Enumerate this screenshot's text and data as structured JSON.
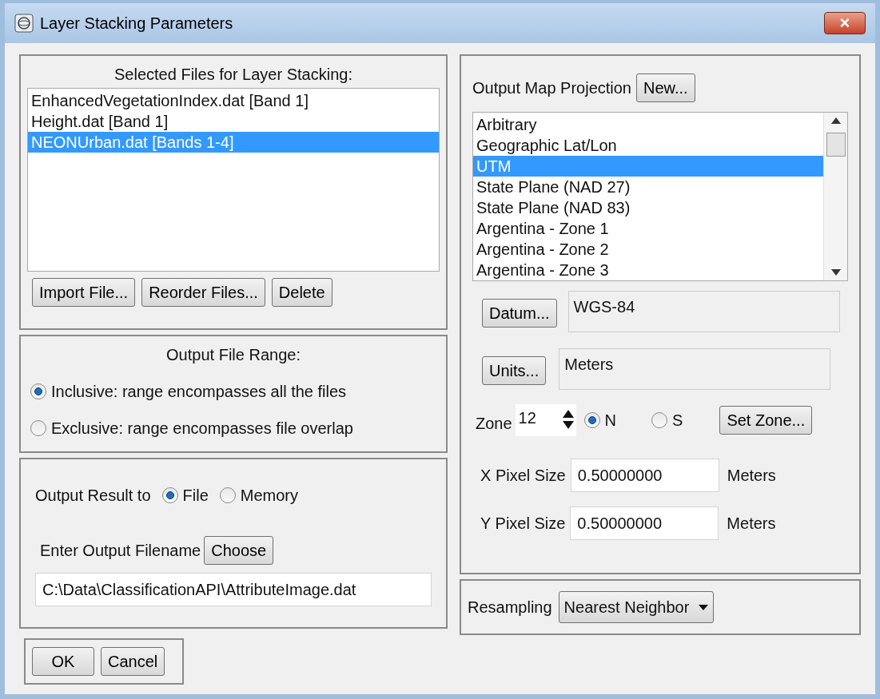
{
  "window": {
    "title": "Layer Stacking Parameters",
    "close": "×"
  },
  "files": {
    "title": "Selected Files for Layer Stacking:",
    "items": [
      {
        "label": "EnhancedVegetationIndex.dat [Band 1]",
        "selected": false
      },
      {
        "label": "Height.dat [Band 1]",
        "selected": false
      },
      {
        "label": "NEONUrban.dat [Bands 1-4]",
        "selected": true
      }
    ],
    "buttons": [
      "Import File...",
      "Reorder Files...",
      "Delete"
    ]
  },
  "range": {
    "title": "Output File Range:",
    "options": [
      {
        "label": "Inclusive: range encompasses all the files",
        "selected": true
      },
      {
        "label": "Exclusive: range encompasses file overlap",
        "selected": false
      }
    ]
  },
  "output": {
    "label": "Output Result to",
    "destinations": [
      {
        "label": "File",
        "selected": true
      },
      {
        "label": "Memory",
        "selected": false
      }
    ],
    "filename_label": "Enter Output Filename",
    "choose_button": "Choose",
    "filename_value": "C:\\Data\\ClassificationAPI\\AttributeImage.dat"
  },
  "buttons": [
    "OK",
    "Cancel"
  ],
  "projection": {
    "label": "Output Map Projection",
    "new_button": "New...",
    "items": [
      {
        "label": "Arbitrary",
        "selected": false
      },
      {
        "label": "Geographic Lat/Lon",
        "selected": false
      },
      {
        "label": "UTM",
        "selected": true
      },
      {
        "label": "State Plane (NAD 27)",
        "selected": false
      },
      {
        "label": "State Plane (NAD 83)",
        "selected": false
      },
      {
        "label": "Argentina - Zone 1",
        "selected": false
      },
      {
        "label": "Argentina - Zone 2",
        "selected": false
      },
      {
        "label": "Argentina - Zone 3",
        "selected": false
      }
    ],
    "datum_button": "Datum...",
    "datum_value": "WGS-84",
    "units_button": "Units...",
    "units_value": "Meters",
    "zone_label": "Zone",
    "zone_value": "12",
    "hemispheres": [
      {
        "label": "N",
        "selected": true
      },
      {
        "label": "S",
        "selected": false
      }
    ],
    "set_zone_button": "Set Zone...",
    "pixel_sizes": [
      {
        "label": "X Pixel Size",
        "value": "0.50000000",
        "units": "Meters"
      },
      {
        "label": "Y Pixel Size",
        "value": "0.50000000",
        "units": "Meters"
      }
    ]
  },
  "resampling": {
    "label": "Resampling",
    "value": "Nearest Neighbor"
  }
}
